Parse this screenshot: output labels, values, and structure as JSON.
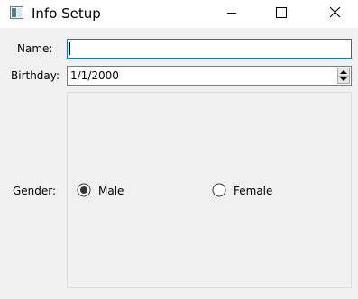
{
  "window": {
    "title": "Info Setup",
    "controls": {
      "minimize_icon": "minimize-icon",
      "maximize_icon": "maximize-icon",
      "close_icon": "close-icon"
    }
  },
  "form": {
    "name": {
      "label": "Name:",
      "value": "",
      "focused": true
    },
    "birthday": {
      "label": "Birthday:",
      "value": "1/1/2000"
    },
    "gender": {
      "label": "Gender:",
      "options": [
        {
          "label": "Male",
          "checked": true
        },
        {
          "label": "Female",
          "checked": false
        }
      ]
    }
  },
  "colors": {
    "focus_border": "#0078d7",
    "window_bg": "#f0f0f0",
    "titlebar_bg": "#ffffff"
  }
}
